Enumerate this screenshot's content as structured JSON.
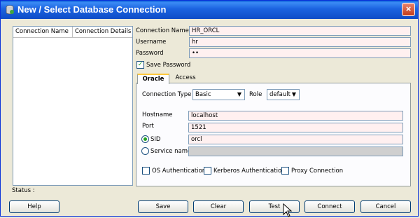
{
  "window": {
    "title": "New / Select Database Connection",
    "close": "×"
  },
  "list": {
    "col1": "Connection Name",
    "col2": "Connection Details"
  },
  "form": {
    "connection_name_label": "Connection Name",
    "connection_name": "HR_ORCL",
    "username_label": "Username",
    "username": "hr",
    "password_label": "Password",
    "password": "••",
    "save_password_label": "Save Password",
    "save_password_checked": "✓"
  },
  "tabs": [
    {
      "label": "Oracle"
    },
    {
      "label": "Access"
    }
  ],
  "oracle": {
    "connection_type_label": "Connection Type",
    "connection_type": "Basic",
    "role_label": "Role",
    "role": "default",
    "hostname_label": "Hostname",
    "hostname": "localhost",
    "port_label": "Port",
    "port": "1521",
    "sid_label": "SID",
    "sid": "orcl",
    "service_name_label": "Service name",
    "service_name": "",
    "os_auth_label": "OS Authentication",
    "kerberos_label": "Kerberos Authentication",
    "proxy_label": "Proxy Connection"
  },
  "status_label": "Status :",
  "buttons": {
    "help": "Help",
    "save": "Save",
    "clear": "Clear",
    "test": "Test",
    "connect": "Connect",
    "cancel": "Cancel"
  },
  "colors": {
    "title_bar": "#1b63e0",
    "field_bg": "#fff0f0",
    "window_bg": "#ece9d8"
  }
}
